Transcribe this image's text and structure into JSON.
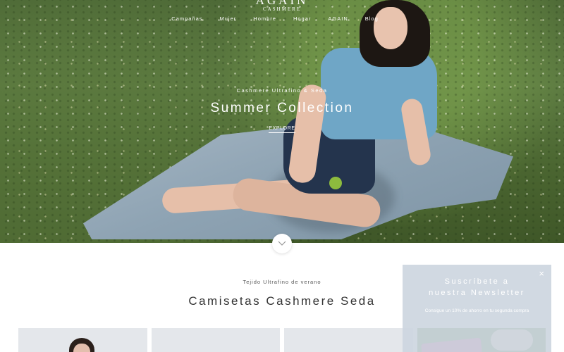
{
  "brand": {
    "logo": "AGAIN",
    "sub": "CASHMERE"
  },
  "nav": {
    "items": [
      "Campañas",
      "Mujer",
      "Hombre",
      "Hogar",
      "AGAIN",
      "Blog"
    ]
  },
  "hero": {
    "kicker": "Cashmere Ultrafino & Seda",
    "title": "Summer Collection",
    "cta": "EXPLORE"
  },
  "section": {
    "kicker": "Tejido Ultrafino de verano",
    "title": "Camisetas Cashmere Seda"
  },
  "newsletter": {
    "title": "Suscríbete a nuestra Newsletter",
    "text": "Consigue un 10% de ahorro en tu segunda compra",
    "close": "×"
  },
  "icons": {
    "scroll": "chevron-down-icon",
    "close": "close-icon"
  }
}
